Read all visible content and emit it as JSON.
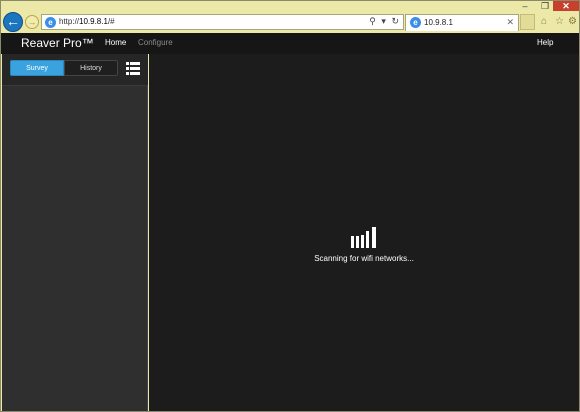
{
  "browser": {
    "window_buttons": {
      "minimize": "–",
      "restore": "❐",
      "close": "✕"
    },
    "nav": {
      "back_glyph": "←",
      "forward_glyph": "→"
    },
    "address": {
      "icon": "ie-icon",
      "scheme": "http://",
      "host": "10.9.8.1",
      "path": "/#",
      "search_glyph": "⚲",
      "dropdown_glyph": "▾",
      "refresh_glyph": "↻"
    },
    "tab": {
      "title": "10.9.8.1",
      "close_glyph": "✕"
    },
    "toolbar": {
      "home_glyph": "⌂",
      "favorites_glyph": "☆",
      "tools_glyph": "⚙"
    }
  },
  "app": {
    "brand": "Reaver Pro™",
    "nav": {
      "home": "Home",
      "configure": "Configure",
      "help": "Help"
    },
    "sidebar": {
      "tabs": {
        "survey": "Survey",
        "history": "History"
      },
      "list_view_icon": "list-view-icon"
    },
    "main": {
      "status": "Scanning for wifi networks...",
      "spinner_icon": "signal-bars-spinner-icon"
    }
  },
  "colors": {
    "accent": "#3aa3df",
    "header_bg": "#161616",
    "sidebar_bg": "#2f2f2f",
    "main_bg": "#1c1c1c",
    "browser_chrome": "#ece9a8"
  }
}
